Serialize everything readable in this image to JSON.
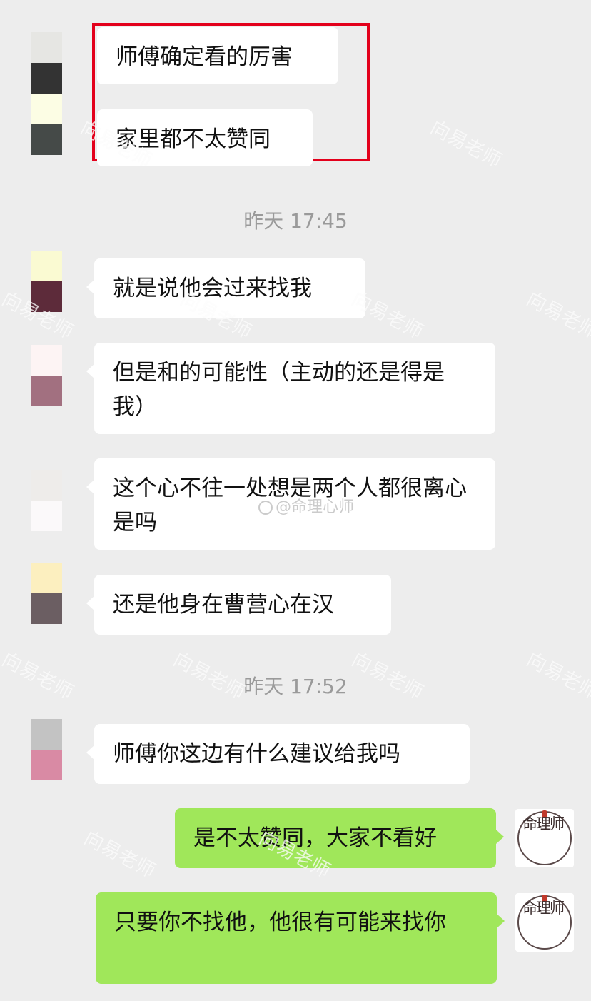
{
  "messages": [
    {
      "dir": "in",
      "text": "师傅确定看的厉害"
    },
    {
      "dir": "in",
      "text": "家里都不太赞同"
    },
    {
      "timestamp": "昨天 17:45"
    },
    {
      "dir": "in",
      "text": "就是说他会过来找我"
    },
    {
      "dir": "in",
      "text": "但是和的可能性（主动的还是得是我）"
    },
    {
      "dir": "in",
      "text": "这个心不往一处想是两个人都很离心是吗"
    },
    {
      "dir": "in",
      "text": "还是他身在曹营心在汉"
    },
    {
      "timestamp": "昨天 17:52"
    },
    {
      "dir": "in",
      "text": "师傅你这边有什么建议给我吗"
    },
    {
      "dir": "out",
      "text": "是不太赞同，大家不看好"
    },
    {
      "dir": "out",
      "text": "只要你不找他，他很有可能来找你"
    }
  ],
  "my_avatar_logo_text": "命理师",
  "watermark_text": "向易老师",
  "center_watermark": "@命理心师",
  "colors": {
    "background": "#ededed",
    "incoming_bubble": "#ffffff",
    "outgoing_bubble": "#a0e75a",
    "highlight_border": "#e3001b",
    "timestamp": "#9a9a9a"
  }
}
